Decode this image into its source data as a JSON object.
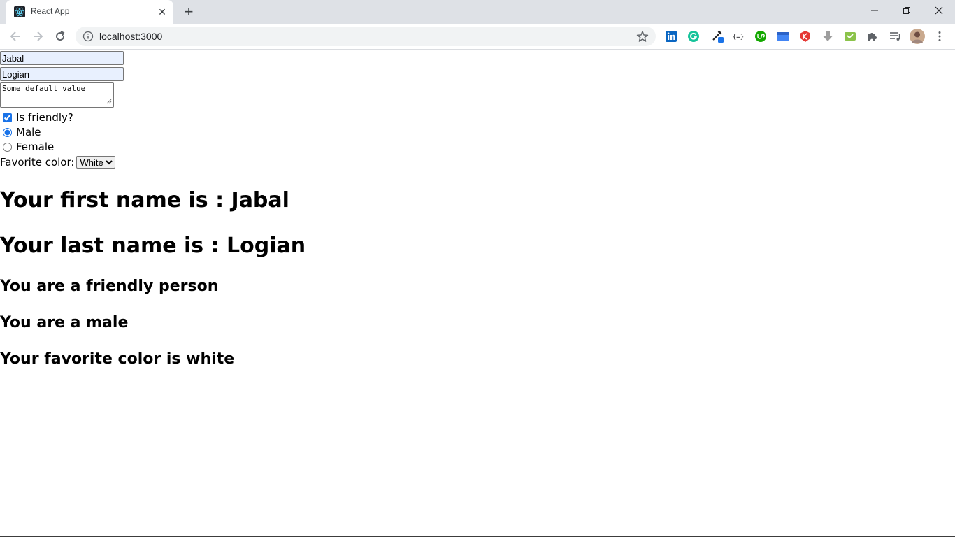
{
  "browser": {
    "tab_title": "React App",
    "new_tab_symbol": "+",
    "close_symbol": "✕",
    "url": "localhost:3000"
  },
  "form": {
    "first_name_value": "Jabal",
    "last_name_value": "Logian",
    "textarea_value": "Some default value",
    "friendly_label": "Is friendly?",
    "friendly_checked": true,
    "gender_options": [
      "Male",
      "Female"
    ],
    "gender_selected": "Male",
    "favorite_color_label": "Favorite color:",
    "favorite_color_selected": "White"
  },
  "results": {
    "first_name_line": "Your first name is : Jabal",
    "last_name_line": "Your last name is : Logian",
    "friendly_line": "You are a friendly person",
    "gender_line": "You are a male",
    "color_line": "Your favorite color is white"
  },
  "extensions": [
    "linkedin-icon",
    "grammarly-icon",
    "eyedropper-icon",
    "json-icon",
    "upwork-icon",
    "calendar-icon",
    "shield-icon",
    "download-icon",
    "inbox-icon",
    "puzzle-icon",
    "media-icon",
    "profile-avatar",
    "menu-icon"
  ],
  "colors": {
    "tabstrip_bg": "#dee1e6",
    "omnibox_bg": "#f1f3f4",
    "input_autofill_bg": "#e8f0fe",
    "accent": "#1a73e8"
  }
}
